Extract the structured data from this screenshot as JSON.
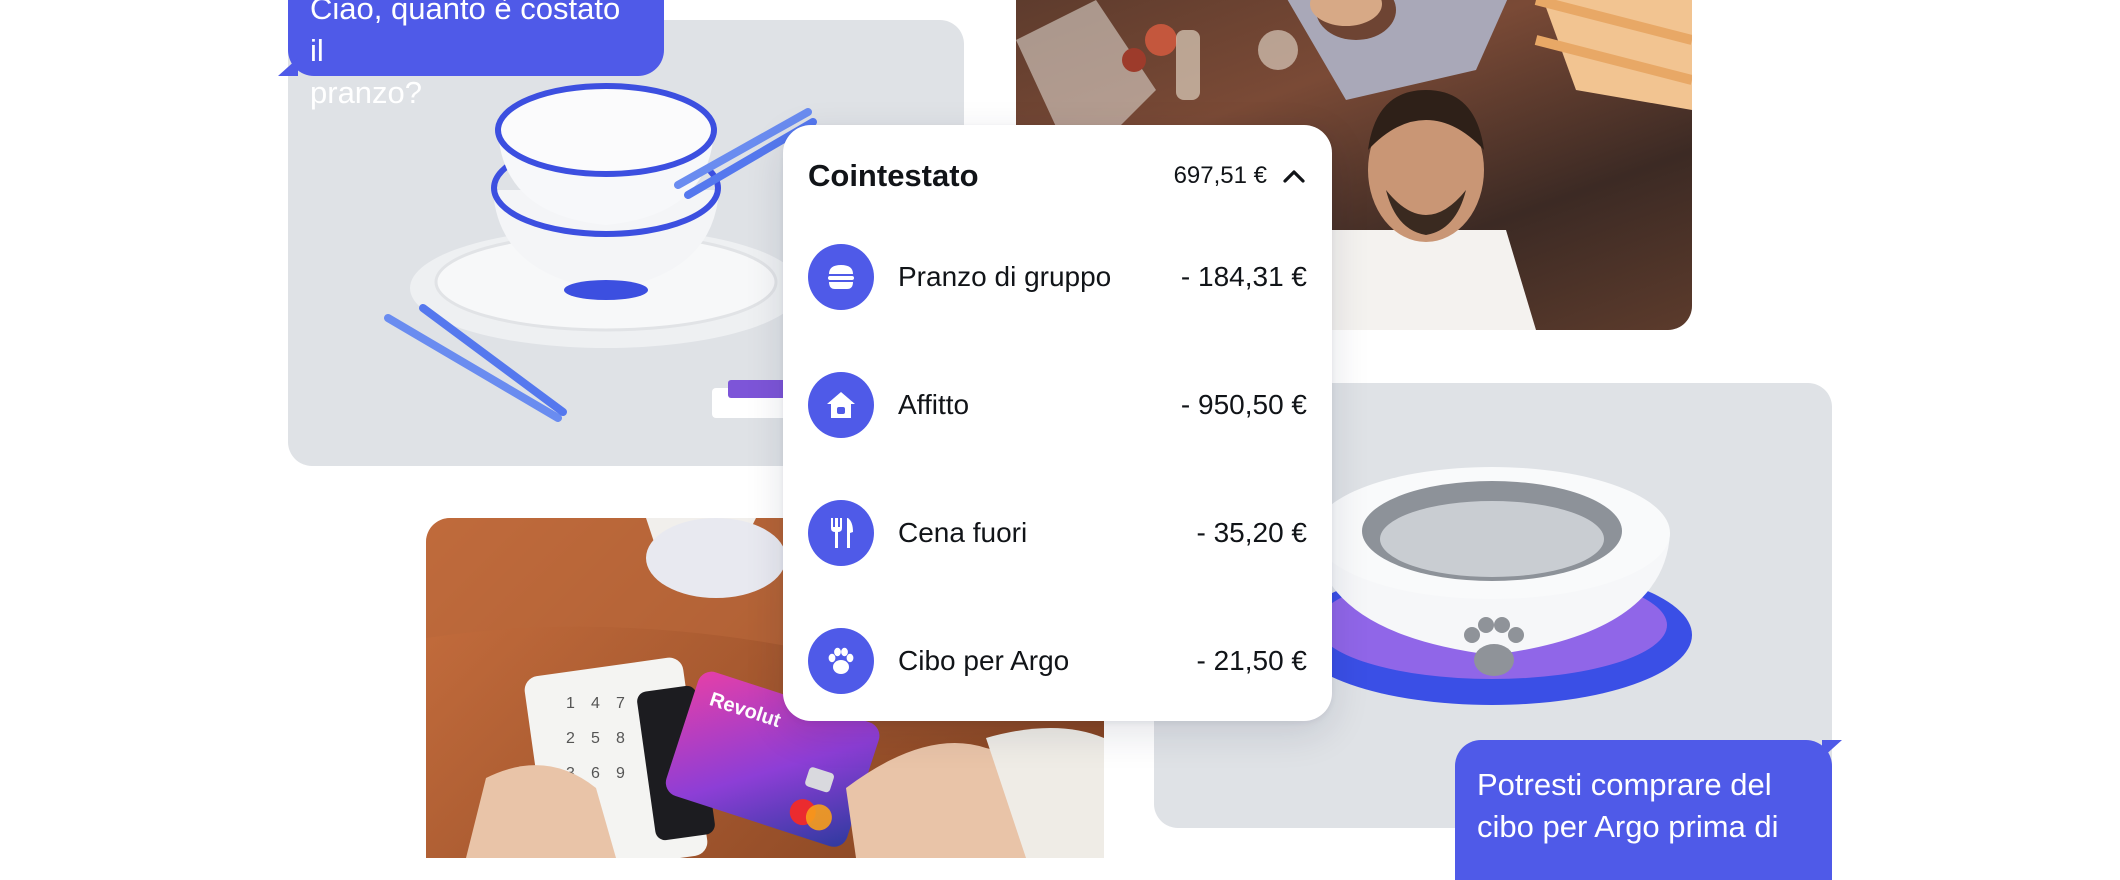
{
  "bubbles": {
    "top": {
      "line1": "Ciao, quanto è costato il",
      "line2": "pranzo?"
    },
    "bottom": {
      "line1": "Potresti comprare del",
      "line2": "cibo per Argo prima di"
    }
  },
  "card": {
    "title": "Cointestato",
    "total": "697,51 €",
    "toggle_icon": "chevron-up-icon",
    "transactions": [
      {
        "label": "Pranzo di gruppo",
        "amount": "- 184,31 €",
        "icon": "burger-icon"
      },
      {
        "label": "Affitto",
        "amount": "- 950,50 €",
        "icon": "house-icon"
      },
      {
        "label": "Cena fuori",
        "amount": "- 35,20 €",
        "icon": "cutlery-icon"
      },
      {
        "label": "Cibo per Argo",
        "amount": "- 21,50 €",
        "icon": "paw-icon"
      }
    ]
  },
  "images": {
    "card_brand": "Revolut"
  },
  "colors": {
    "accent": "#4f5ae8",
    "tile_gray": "#dfe2e6",
    "text": "#111418"
  }
}
